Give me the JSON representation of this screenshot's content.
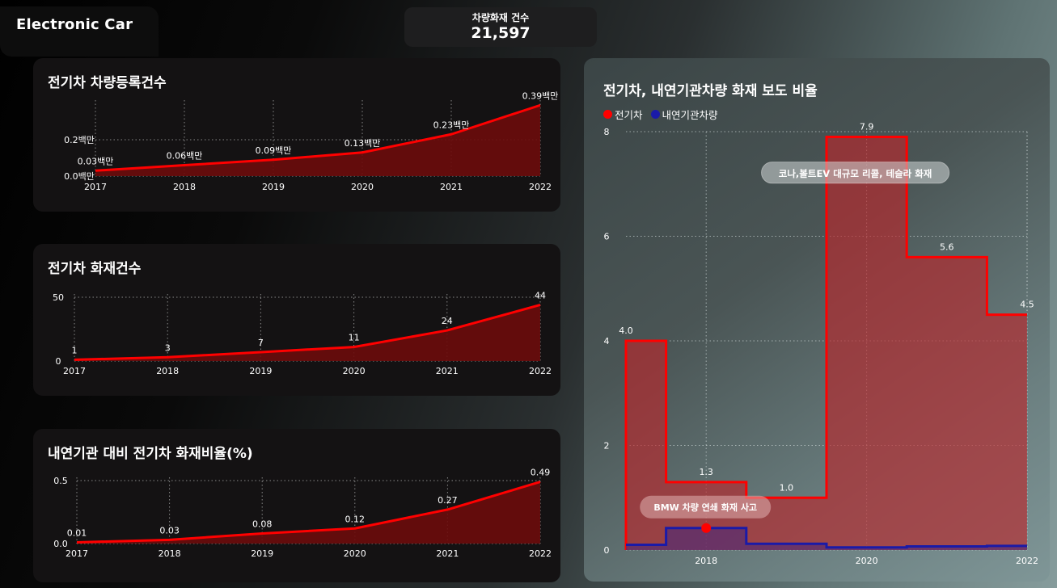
{
  "brand": {
    "title": "Electronic Car"
  },
  "kpi": {
    "label": "차량화재 건수",
    "value": "21,597"
  },
  "colors": {
    "ev": "#ff0000",
    "ice": "#1a1aa8",
    "fill": "#6b0c0c"
  },
  "chart_data": [
    {
      "type": "area",
      "title": "전기차 차량등록건수",
      "x": [
        "2017",
        "2018",
        "2019",
        "2020",
        "2021",
        "2022"
      ],
      "values": [
        0.03,
        0.06,
        0.09,
        0.13,
        0.23,
        0.39
      ],
      "data_labels": [
        "0.03백만",
        "0.06백만",
        "0.09백만",
        "0.13백만",
        "0.23백만",
        "0.39백만"
      ],
      "yticks": [
        {
          "value": 0.0,
          "label": "0.0백만"
        },
        {
          "value": 0.2,
          "label": "0.2백만"
        }
      ],
      "ylim": [
        0,
        0.4
      ],
      "grid": true
    },
    {
      "type": "area",
      "title": "전기차 화재건수",
      "x": [
        "2017",
        "2018",
        "2019",
        "2020",
        "2021",
        "2022"
      ],
      "values": [
        1,
        3,
        7,
        11,
        24,
        44
      ],
      "data_labels": [
        "1",
        "3",
        "7",
        "11",
        "24",
        "44"
      ],
      "yticks": [
        {
          "value": 0,
          "label": "0"
        },
        {
          "value": 50,
          "label": "50"
        }
      ],
      "ylim": [
        0,
        50
      ],
      "grid": true
    },
    {
      "type": "area",
      "title": "내연기관 대비 전기차 화재비율(%)",
      "x": [
        "2017",
        "2018",
        "2019",
        "2020",
        "2021",
        "2022"
      ],
      "values": [
        0.01,
        0.03,
        0.08,
        0.12,
        0.27,
        0.49
      ],
      "data_labels": [
        "0.01",
        "0.03",
        "0.08",
        "0.12",
        "0.27",
        "0.49"
      ],
      "yticks": [
        {
          "value": 0,
          "label": "0.0"
        },
        {
          "value": 0.5,
          "label": "0.5"
        }
      ],
      "ylim": [
        0,
        0.5
      ],
      "grid": true
    },
    {
      "type": "area",
      "step": true,
      "title": "전기차, 내연기관차량 화재 보도 비율",
      "x": [
        2017,
        2018,
        2019,
        2020,
        2021,
        2022
      ],
      "xticks": [
        "2018",
        "2020",
        "2022"
      ],
      "yticks": [
        "0",
        "2",
        "4",
        "6",
        "8"
      ],
      "ylim": [
        0,
        8
      ],
      "grid": true,
      "legend": "top-left",
      "series": [
        {
          "name": "전기차",
          "values": [
            4.0,
            1.3,
            1.0,
            7.9,
            5.6,
            4.5
          ],
          "data_labels": [
            "4.0",
            "1.3",
            "1.0",
            "7.9",
            "5.6",
            "4.5"
          ]
        },
        {
          "name": "내연기관차량",
          "values": [
            0.1,
            0.42,
            0.12,
            0.05,
            0.07,
            0.08
          ]
        }
      ],
      "annotations": [
        {
          "text": "코나,볼트EV 대규모 리콜, 테슬라 화재",
          "x": 2020,
          "y": 7.2
        },
        {
          "text": "BMW 차량 연쇄 화재 사고",
          "x": 2018,
          "y": 0.42
        }
      ]
    }
  ]
}
